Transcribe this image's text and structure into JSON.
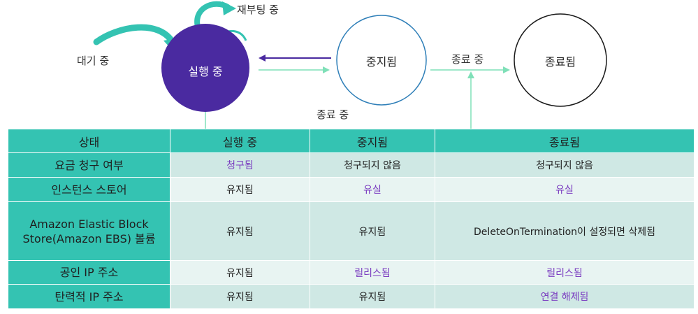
{
  "diagram": {
    "states": {
      "running": "실행 중",
      "stopped": "중지됨",
      "terminated": "종료됨"
    },
    "transitions": {
      "pending": "대기 중",
      "rebooting": "재부팅 중",
      "terminating_from_running": "종료 중",
      "terminating_from_stopped": "종료 중"
    },
    "colors": {
      "running_fill": "#4a2aa0",
      "stopped_stroke": "#2f7fb8",
      "accent_teal": "#34c3b2",
      "arrow_purple": "#4a2aa0",
      "arrow_mint": "#7fe0b8"
    }
  },
  "table": {
    "headers": [
      "상태",
      "실행 중",
      "중지됨",
      "종료됨"
    ],
    "rows": [
      {
        "label": "요금 청구 여부",
        "cells": [
          "청구됨",
          "청구되지 않음",
          "청구되지 않음"
        ],
        "purple": [
          true,
          false,
          false
        ]
      },
      {
        "label": "인스턴스 스토어",
        "cells": [
          "유지됨",
          "유실",
          "유실"
        ],
        "purple": [
          false,
          true,
          true
        ]
      },
      {
        "label_lines": [
          "Amazon Elastic Block",
          "Store(Amazon EBS) 볼륨"
        ],
        "cells": [
          "유지됨",
          "유지됨",
          "DeleteOnTermination이 설정되면 삭제됨"
        ],
        "purple": [
          false,
          false,
          false
        ]
      },
      {
        "label": "공인 IP 주소",
        "cells": [
          "유지됨",
          "릴리스됨",
          "릴리스됨"
        ],
        "purple": [
          false,
          true,
          true
        ]
      },
      {
        "label": "탄력적 IP 주소",
        "cells": [
          "유지됨",
          "유지됨",
          "연결 해제됨"
        ],
        "purple": [
          false,
          false,
          true
        ]
      }
    ]
  }
}
